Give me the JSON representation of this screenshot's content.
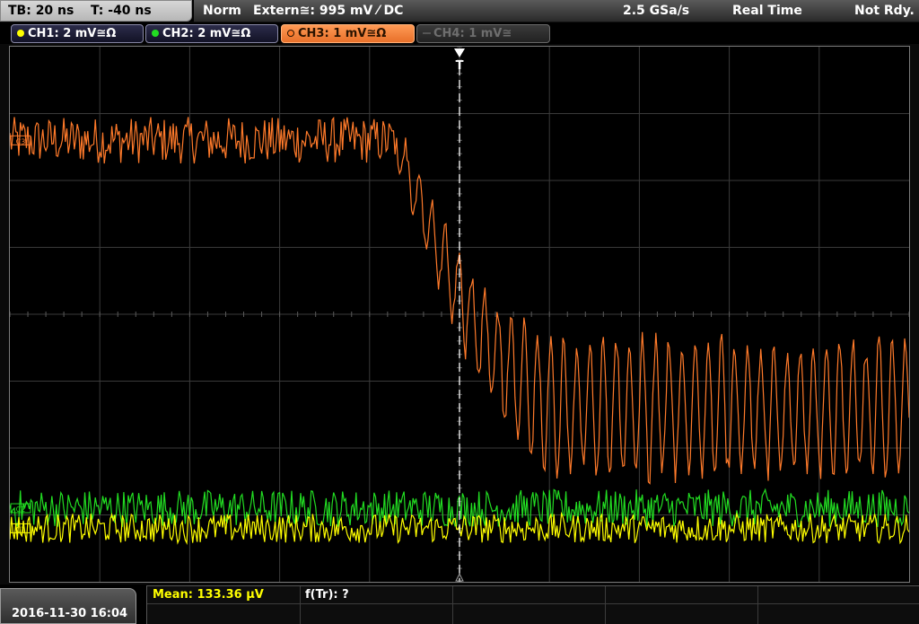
{
  "header": {
    "timebase": "TB: 20 ns",
    "trigger_time": "T: -40 ns",
    "trigger_mode": "Norm",
    "trigger_source": "Extern≅: 995 mV ⁄ DC",
    "sample_rate": "2.5 GSa/s",
    "acquisition_mode": "Real Time",
    "status": "Not Rdy."
  },
  "channels": [
    {
      "label": "CH1: 2 mV≅Ω",
      "color": "#ffff00",
      "state": "on"
    },
    {
      "label": "CH2: 2 mV≅Ω",
      "color": "#22dd22",
      "state": "on"
    },
    {
      "label": "CH3: 1 mV≅Ω",
      "color": "#ff7a2a",
      "state": "selected"
    },
    {
      "label": "CH4: 1 mV≅",
      "color": "#666666",
      "state": "off"
    }
  ],
  "markers": {
    "trigger_label": "T",
    "ch3_label": "C3",
    "ch1_label": "C1",
    "ch2_label": "C2"
  },
  "footer": {
    "datetime": "2016-11-30 16:04",
    "mean": "Mean: 133.36 µV",
    "rise_freq": "f(Tr): ?"
  },
  "colors": {
    "ch1": "#ffff00",
    "ch2": "#22dd22",
    "ch3": "#ff7a2a",
    "grid": "#3a3a3a"
  },
  "chart_data": {
    "type": "line",
    "x_unit": "ns",
    "x_range": [
      -140,
      60
    ],
    "x_divisions": 10,
    "y_divisions": 8,
    "trigger_x": -40,
    "series": [
      {
        "name": "CH3",
        "profile": "step-down with ringing",
        "pre_level_div": 2.6,
        "post_level_div": -1.4,
        "step_start_ns": -54,
        "noise_pre_div": 0.35,
        "ring_amp_div": 1.1
      },
      {
        "name": "CH2",
        "profile": "noise",
        "level_div": -2.9,
        "noise_div": 0.28
      },
      {
        "name": "CH1",
        "profile": "noise",
        "level_div": -3.2,
        "noise_div": 0.22
      }
    ]
  }
}
